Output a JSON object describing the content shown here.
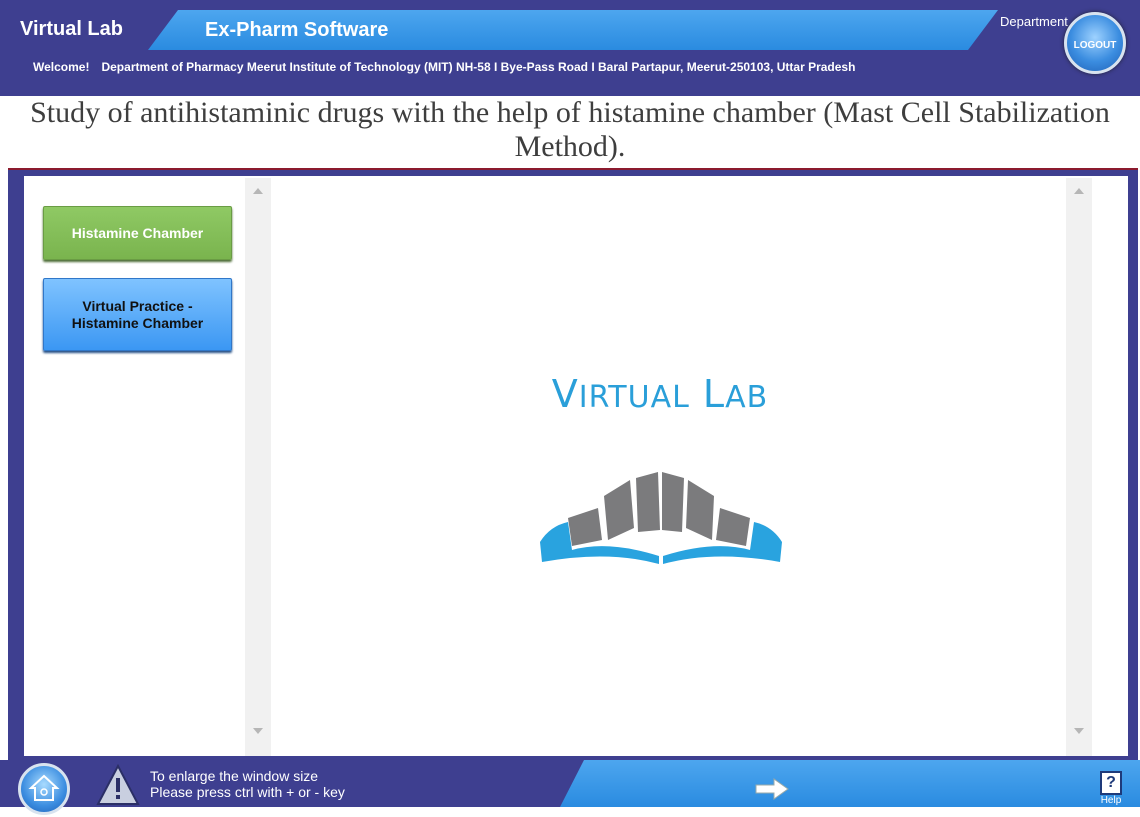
{
  "header": {
    "brand": "Virtual Lab",
    "app_name": "Ex-Pharm Software",
    "department_label": "Department",
    "logout_label": "LOGOUT",
    "welcome_label": "Welcome!",
    "welcome_text": "Department of Pharmacy Meerut Institute of Technology (MIT) NH-58 I Bye-Pass Road I Baral Partapur, Meerut-250103, Uttar Pradesh"
  },
  "page": {
    "title": "Study of antihistaminic drugs with the help of histamine chamber (Mast Cell Stabilization Method)."
  },
  "sidebar": {
    "items": [
      {
        "label": "Histamine Chamber"
      },
      {
        "label": "Virtual Practice - Histamine Chamber"
      }
    ]
  },
  "content": {
    "logo_text_v": "V",
    "logo_text_irtual": "IRTUAL",
    "logo_text_l": "L",
    "logo_text_ab": "AB"
  },
  "footer": {
    "enlarge_line1": "To enlarge the window size",
    "enlarge_line2": "Please press ctrl with + or - key",
    "help_label": "Help"
  },
  "colors": {
    "header_bg": "#3e3f90",
    "tab_blue": "#2a8be0",
    "green_button": "#7ab44e",
    "blue_button": "#3b97f3",
    "logo_blue": "#2a9fd9",
    "logo_gray": "#7b7b7d"
  }
}
